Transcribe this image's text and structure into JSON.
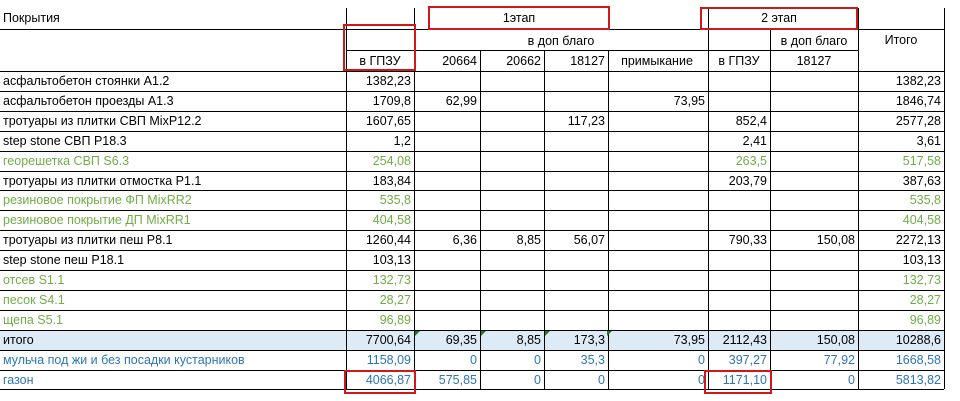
{
  "colors": {
    "black": "#000000",
    "green": "#70ad47",
    "blue": "#2e75b6",
    "total_row_bg": "#ddebf7",
    "highlight_red": "#d01818"
  },
  "header": {
    "coverage": "Покрытия",
    "stage1": "1этап",
    "stage2": "2 этап",
    "dop_blago_1": "в доп благо",
    "dop_blago_2": "в доп благо",
    "total": "Итого",
    "gpzu_1": "в ГПЗУ",
    "c20664": "20664",
    "c20662": "20662",
    "c18127_1": "18127",
    "primykanie": "примыкание",
    "gpzu_2": "в ГПЗУ",
    "c18127_2": "18127"
  },
  "rows": [
    {
      "label": "асфальтобетон стоянки А1.2",
      "color": "black",
      "cells": [
        "1382,23",
        "",
        "",
        "",
        "",
        "",
        "",
        "1382,23"
      ]
    },
    {
      "label": "асфальтобетон проезды А1.3",
      "color": "black",
      "cells": [
        "1709,8",
        "62,99",
        "",
        "",
        "73,95",
        "",
        "",
        "1846,74"
      ]
    },
    {
      "label": "тротуары из плитки СВП MixP12.2",
      "color": "black",
      "cells": [
        "1607,65",
        "",
        "",
        "117,23",
        "",
        "852,4",
        "",
        "2577,28"
      ]
    },
    {
      "label": "step stone СВП Р18.3",
      "color": "black",
      "cells": [
        "1,2",
        "",
        "",
        "",
        "",
        "2,41",
        "",
        "3,61"
      ]
    },
    {
      "label": "георешетка СВП S6.3",
      "color": "green",
      "cells": [
        "254,08",
        "",
        "",
        "",
        "",
        "263,5",
        "",
        "517,58"
      ]
    },
    {
      "label": "тротуары из плитки отмостка Р1.1",
      "color": "black",
      "cells": [
        "183,84",
        "",
        "",
        "",
        "",
        "203,79",
        "",
        "387,63"
      ]
    },
    {
      "label": "резиновое покрытие ФП MixRR2",
      "color": "green",
      "cells": [
        "535,8",
        "",
        "",
        "",
        "",
        "",
        "",
        "535,8"
      ]
    },
    {
      "label": "резиновое покрытие ДП MixRR1",
      "color": "green",
      "cells": [
        "404,58",
        "",
        "",
        "",
        "",
        "",
        "",
        "404,58"
      ]
    },
    {
      "label": "тротуары из плитки пеш Р8.1",
      "color": "black",
      "cells": [
        "1260,44",
        "6,36",
        "8,85",
        "56,07",
        "",
        "790,33",
        "150,08",
        "2272,13"
      ]
    },
    {
      "label": "step stone пеш Р18.1",
      "color": "black",
      "cells": [
        "103,13",
        "",
        "",
        "",
        "",
        "",
        "",
        "103,13"
      ]
    },
    {
      "label": "отсев S1.1",
      "color": "green",
      "cells": [
        "132,73",
        "",
        "",
        "",
        "",
        "",
        "",
        "132,73"
      ]
    },
    {
      "label": "песок S4.1",
      "color": "green",
      "cells": [
        "28,27",
        "",
        "",
        "",
        "",
        "",
        "",
        "28,27"
      ]
    },
    {
      "label": "щепа S5.1",
      "color": "green",
      "cells": [
        "96,89",
        "",
        "",
        "",
        "",
        "",
        "",
        "96,89"
      ]
    },
    {
      "label": "итого",
      "color": "black",
      "cells": [
        "7700,64",
        "69,35",
        "8,85",
        "173,3",
        "73,95",
        "2112,43",
        "150,08",
        "10288,6"
      ]
    },
    {
      "label": "мульча под жи и без посадки кустарников",
      "color": "blue",
      "cells": [
        "1158,09",
        "0",
        "0",
        "35,3",
        "0",
        "397,27",
        "77,92",
        "1668,58"
      ]
    },
    {
      "label": "газон",
      "color": "blue",
      "cells": [
        "4066,87",
        "575,85",
        "0",
        "0",
        "0",
        "1171,10",
        "0",
        "5813,82"
      ]
    }
  ]
}
